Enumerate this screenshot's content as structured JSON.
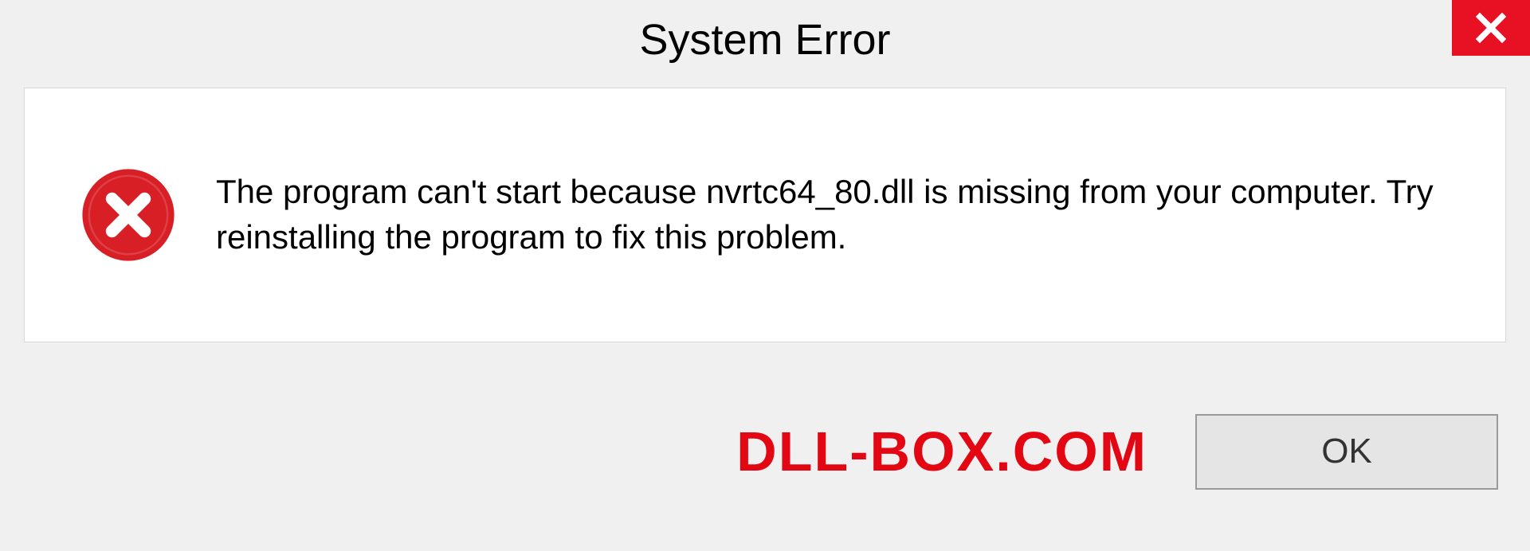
{
  "dialog": {
    "title": "System Error",
    "message": "The program can't start because nvrtc64_80.dll is missing from your computer. Try reinstalling the program to fix this problem.",
    "ok_label": "OK"
  },
  "watermark": "DLL-BOX.COM",
  "colors": {
    "close_bg": "#e81123",
    "error_icon": "#d81f26",
    "watermark": "#e30613"
  }
}
